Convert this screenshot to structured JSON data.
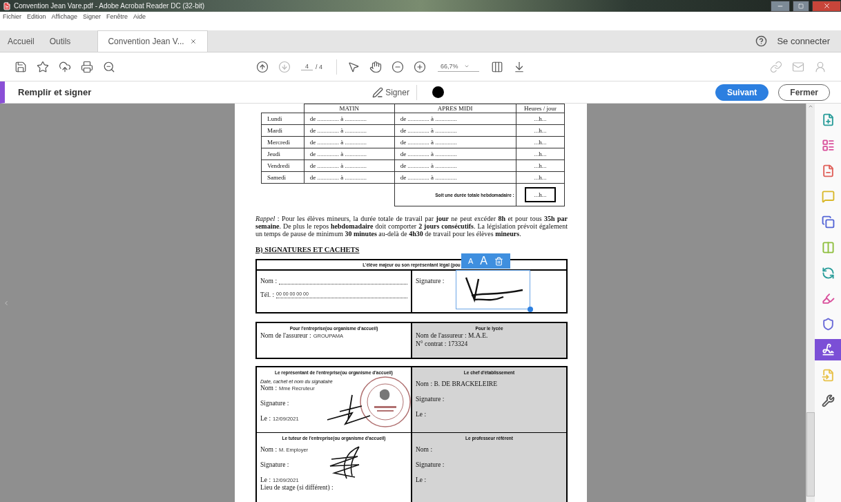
{
  "window": {
    "title": "Convention Jean Vare.pdf - Adobe Acrobat Reader DC (32-bit)"
  },
  "menu": [
    "Fichier",
    "Edition",
    "Affichage",
    "Signer",
    "Fenêtre",
    "Aide"
  ],
  "tabs": [
    {
      "label": "Accueil",
      "selected": false,
      "closable": false
    },
    {
      "label": "Outils",
      "selected": false,
      "closable": false
    },
    {
      "label": "Convention Jean V...",
      "selected": true,
      "closable": true
    }
  ],
  "account": {
    "label": "Se connecter"
  },
  "toolbar": {
    "file_tools": [
      {
        "kind": "save"
      },
      {
        "kind": "bookmark"
      },
      {
        "kind": "upload"
      },
      {
        "kind": "print"
      },
      {
        "kind": "zoom_search"
      }
    ],
    "page_nav": [
      {
        "kind": "previous",
        "disabled": false
      },
      {
        "kind": "next",
        "disabled": true
      }
    ],
    "page": "4",
    "page_total": "/ 4",
    "view_tools": [
      {
        "kind": "select"
      },
      {
        "kind": "hand"
      },
      {
        "kind": "zoom_out"
      },
      {
        "kind": "zoom_in"
      }
    ],
    "zoom": "66,7%",
    "layout_tools": [
      {
        "kind": "fit"
      },
      {
        "kind": "scroll"
      }
    ],
    "share_tools": [
      {
        "kind": "link",
        "disabled": true
      },
      {
        "kind": "mail",
        "disabled": true
      },
      {
        "kind": "user",
        "disabled": true
      }
    ]
  },
  "fill_sign": {
    "title": "Remplir et signer",
    "sign_label": "Signer",
    "buttons": [
      {
        "label": "Suivant",
        "kind": "primary"
      },
      {
        "label": "Fermer",
        "kind": "secondary"
      }
    ]
  },
  "document": {
    "schedule": {
      "columns": [
        "MATIN",
        "APRES MIDI",
        "Heures / jour"
      ],
      "rows": [
        {
          "day": "Lundi",
          "morning": "de .............. à ..............",
          "afternoon": "de .............. à ..............",
          "hours": "...h..."
        },
        {
          "day": "Mardi",
          "morning": "de .............. à ..............",
          "afternoon": "de .............. à ..............",
          "hours": "...h..."
        },
        {
          "day": "Mercredi",
          "morning": "de .............. à ..............",
          "afternoon": "de .............. à ..............",
          "hours": "...h..."
        },
        {
          "day": "Jeudi",
          "morning": "de .............. à ..............",
          "afternoon": "de .............. à ..............",
          "hours": "...h..."
        },
        {
          "day": "Vendredi",
          "morning": "de .............. à ..............",
          "afternoon": "de .............. à ..............",
          "hours": "...h..."
        },
        {
          "day": "Samedi",
          "morning": "de .............. à ..............",
          "afternoon": "de .............. à ..............",
          "hours": "...h..."
        }
      ],
      "total_label": "Soit une durée totale hebdomadaire :",
      "total": "...h..."
    },
    "notice": "*Rappel* : Pour les élèves mineurs, la durée totale de travail par **jour** ne peut excéder **8h** et pour tous **35h par semaine**. De plus le repos **hebdomadaire** doit comporter **2 jours consécutifs**. La législation prévoit également un temps de pause de minimum **30 minutes** au-delà de **4h30** de travail pour les élèves **mineurs**.",
    "section_heading": "B) SIGNATURES ET CACHETS",
    "student_block": {
      "header": "L'élève majeur ou son représentant légal (pou",
      "name_label": "Nom :",
      "phone_label": "Tél. :",
      "phone": "00 00 00 00 00",
      "signature_label": "Signature :",
      "signature_tools": [
        {
          "kind": "smaller",
          "label": "A"
        },
        {
          "kind": "larger",
          "label": "A"
        },
        {
          "kind": "delete"
        }
      ]
    },
    "insurance": [
      {
        "title": "Pour l'entreprise(ou organisme d'accueil)",
        "shaded": false,
        "lines": [
          {
            "label": "Nom de l'assureur :",
            "value": "GROUPAMA"
          }
        ]
      },
      {
        "title": "Pour le lycée",
        "shaded": true,
        "lines": [
          {
            "label": "Nom de l'assureur : M.A.E."
          },
          {
            "label": "N° contrat : 173324"
          }
        ]
      }
    ],
    "signatories": [
      {
        "title": "Le représentant de l'entreprise(ou organisme d'accueil)",
        "note": "Date, cachet et nom du signataire",
        "shaded": false,
        "stamped": true,
        "signed": true,
        "fields": [
          {
            "label": "Nom :",
            "value": "Mme Recruteur"
          },
          {
            "label": "Signature :"
          },
          {
            "label": "Le :",
            "value": "12/09/2021"
          }
        ]
      },
      {
        "title": "Le chef d'établissement",
        "shaded": true,
        "stamped": false,
        "signed": false,
        "fields": [
          {
            "label": "Nom : B. DE BRACKELEIRE"
          },
          {
            "label": "Signature :"
          },
          {
            "label": "Le :"
          }
        ]
      },
      {
        "title": "Le tuteur de l'entreprise(ou organisme d'accueil)",
        "shaded": false,
        "stamped": false,
        "signed": true,
        "fields": [
          {
            "label": "Nom :",
            "value": "M. Employer"
          },
          {
            "label": "Signature :"
          },
          {
            "label": "Le :",
            "value": "12/09/2021"
          },
          {
            "label": "Lieu de stage (si différent) :"
          }
        ]
      },
      {
        "title": "Le professeur référent",
        "shaded": true,
        "stamped": false,
        "signed": false,
        "fields": [
          {
            "label": "Nom :"
          },
          {
            "label": "Signature :"
          },
          {
            "label": "Le :"
          }
        ]
      }
    ]
  },
  "tools_panel": [
    {
      "kind": "create",
      "color": "#2a9d9a",
      "selected": false
    },
    {
      "kind": "form",
      "color": "#d94f9b",
      "selected": false
    },
    {
      "kind": "remove",
      "color": "#e0605a",
      "selected": false
    },
    {
      "kind": "comment",
      "color": "#d9b82a",
      "selected": false
    },
    {
      "kind": "export",
      "color": "#5566d6",
      "selected": false
    },
    {
      "kind": "organize",
      "color": "#8fbf3f",
      "selected": false
    },
    {
      "kind": "convert",
      "color": "#2a9d9a",
      "selected": false
    },
    {
      "kind": "highlight",
      "color": "#d94f9b",
      "selected": false
    },
    {
      "kind": "protect",
      "color": "#6a6ad8",
      "selected": false
    },
    {
      "kind": "sign",
      "color": "#7b4fd6",
      "selected": true
    },
    {
      "kind": "send",
      "color": "#e8c24a",
      "selected": false
    },
    {
      "kind": "tools",
      "color": "#555555",
      "selected": false
    }
  ]
}
